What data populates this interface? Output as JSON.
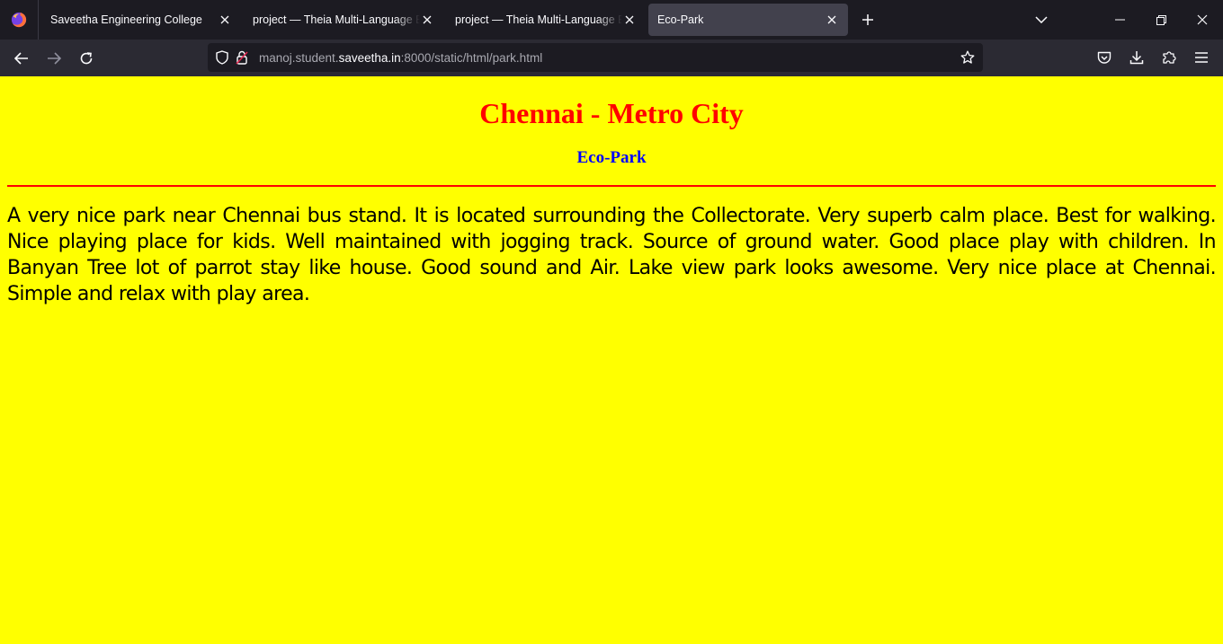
{
  "browser": {
    "tabs": [
      {
        "title": "Saveetha Engineering College",
        "active": false
      },
      {
        "title": "project — Theia Multi-Language Explorer",
        "active": false
      },
      {
        "title": "project — Theia Multi-Language Explorer",
        "active": false
      },
      {
        "title": "Eco-Park",
        "active": true
      }
    ],
    "url": {
      "prefix": "manoj.student.",
      "host": "saveetha.in",
      "suffix": ":8000/static/html/park.html"
    },
    "icons": {
      "logo": "firefox-icon",
      "back": "arrow-left-icon",
      "forward": "arrow-right-icon",
      "reload": "reload-icon",
      "shield": "shield-icon",
      "lock": "insecure-lock-icon",
      "bookmark": "star-icon",
      "pocket": "pocket-icon",
      "downloads": "download-icon",
      "extensions": "puzzle-icon",
      "menu": "hamburger-menu-icon"
    }
  },
  "page": {
    "heading": "Chennai - Metro City",
    "subheading": "Eco-Park",
    "paragraph": "A very nice park near Chennai bus stand. It is located surrounding the Collectorate. Very superb calm place. Best for walking. Nice playing place for kids. Well maintained with jogging track. Source of ground water. Good place play with children. In Banyan Tree lot of parrot stay like house. Good sound and Air. Lake view park looks awesome. Very nice place at Chennai. Simple and relax with play area.",
    "colors": {
      "background": "#ffff00",
      "heading": "#ff0000",
      "subheading": "#0000ff",
      "rule": "#ff0000"
    }
  }
}
